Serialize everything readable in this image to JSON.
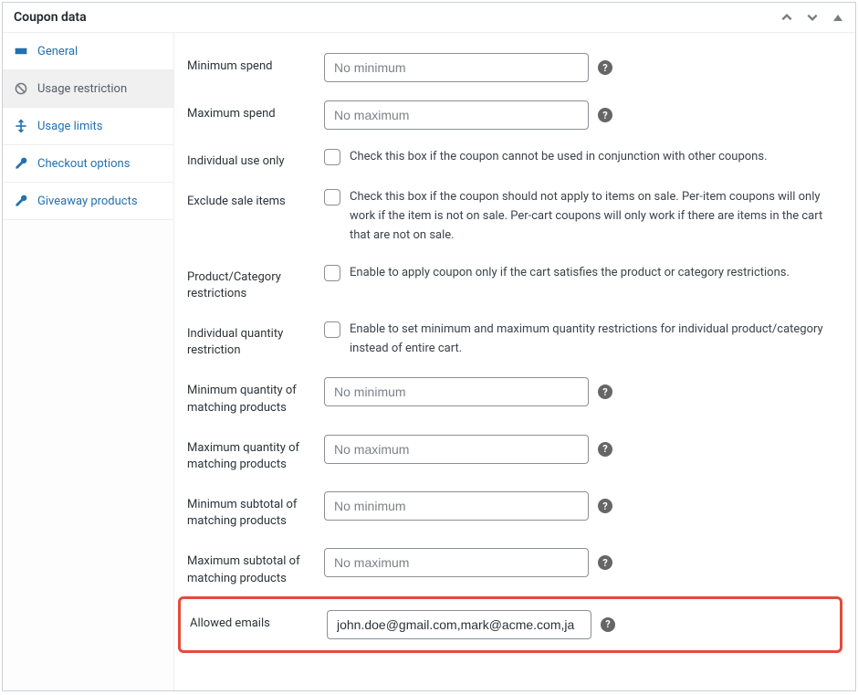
{
  "panel": {
    "title": "Coupon data"
  },
  "tabs": {
    "general": {
      "label": "General"
    },
    "usage_restriction": {
      "label": "Usage restriction"
    },
    "usage_limits": {
      "label": "Usage limits"
    },
    "checkout_options": {
      "label": "Checkout options"
    },
    "giveaway_products": {
      "label": "Giveaway products"
    }
  },
  "fields": {
    "min_spend": {
      "label": "Minimum spend",
      "placeholder": "No minimum"
    },
    "max_spend": {
      "label": "Maximum spend",
      "placeholder": "No maximum"
    },
    "individual_use": {
      "label": "Individual use only",
      "desc": "Check this box if the coupon cannot be used in conjunction with other coupons."
    },
    "exclude_sale": {
      "label": "Exclude sale items",
      "desc": "Check this box if the coupon should not apply to items on sale. Per-item coupons will only work if the item is not on sale. Per-cart coupons will only work if there are items in the cart that are not on sale."
    },
    "product_cat": {
      "label": "Product/Category restrictions",
      "desc": "Enable to apply coupon only if the cart satisfies the product or category restrictions."
    },
    "indiv_qty": {
      "label": "Individual quantity restriction",
      "desc": "Enable to set minimum and maximum quantity restrictions for individual product/category instead of entire cart."
    },
    "min_qty": {
      "label": "Minimum quantity of matching products",
      "placeholder": "No minimum"
    },
    "max_qty": {
      "label": "Maximum quantity of matching products",
      "placeholder": "No maximum"
    },
    "min_subtotal": {
      "label": "Minimum subtotal of matching products",
      "placeholder": "No minimum"
    },
    "max_subtotal": {
      "label": "Maximum subtotal of matching products",
      "placeholder": "No maximum"
    },
    "allowed_emails": {
      "label": "Allowed emails",
      "value": "john.doe@gmail.com,mark@acme.com,ja"
    }
  }
}
